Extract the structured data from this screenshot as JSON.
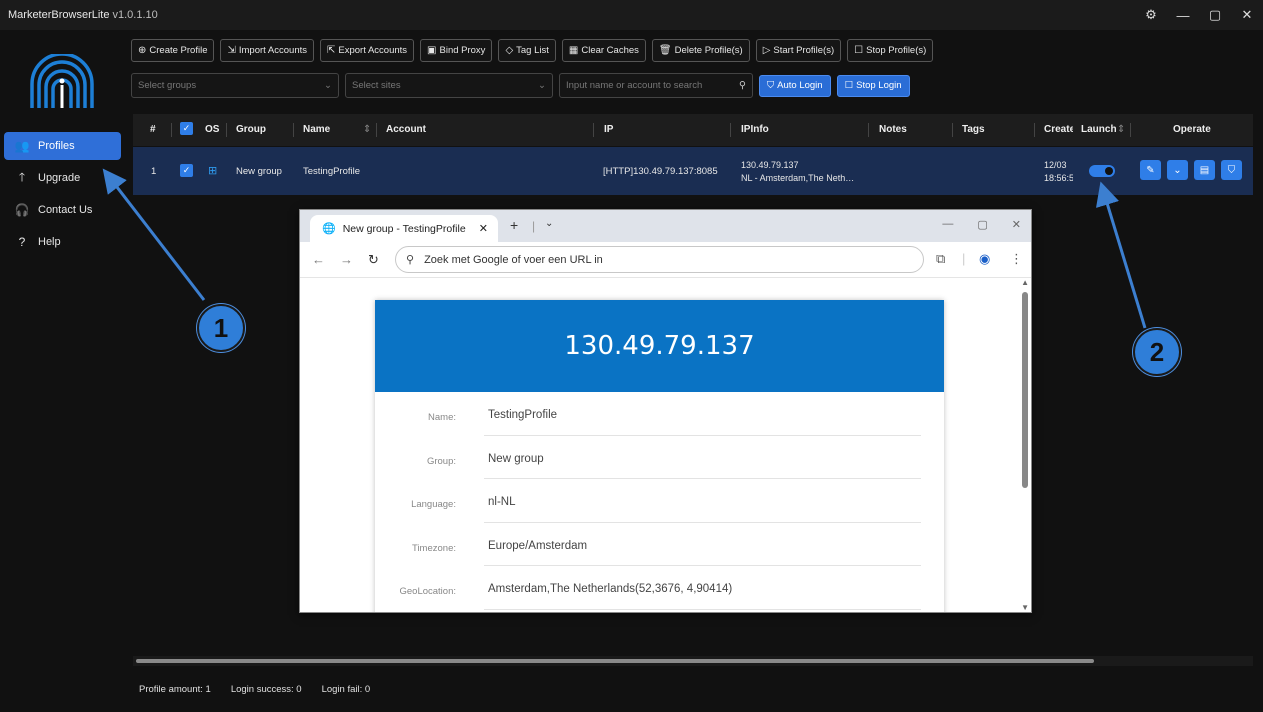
{
  "app": {
    "name": "MarketerBrowserLite",
    "version": "v1.0.1.10"
  },
  "window_controls": [
    "⚙",
    "—",
    "▢",
    "✕"
  ],
  "sidebar": {
    "items": [
      {
        "label": "Profiles",
        "icon": "users-icon",
        "active": true
      },
      {
        "label": "Upgrade",
        "icon": "arrow-up-icon",
        "active": false
      },
      {
        "label": "Contact Us",
        "icon": "headset-icon",
        "active": false
      },
      {
        "label": "Help",
        "icon": "question-icon",
        "active": false
      }
    ]
  },
  "toolbar": {
    "buttons": [
      {
        "label": "Create Profile",
        "icon": "plus-circle-icon"
      },
      {
        "label": "Import Accounts",
        "icon": "import-icon"
      },
      {
        "label": "Export Accounts",
        "icon": "export-icon"
      },
      {
        "label": "Bind Proxy",
        "icon": "proxy-icon"
      },
      {
        "label": "Tag List",
        "icon": "tag-icon"
      },
      {
        "label": "Clear Caches",
        "icon": "broom-icon"
      },
      {
        "label": "Delete Profile(s)",
        "icon": "trash-icon"
      },
      {
        "label": "Start Profile(s)",
        "icon": "play-icon"
      },
      {
        "label": "Stop Profile(s)",
        "icon": "stop-icon"
      }
    ]
  },
  "filters": {
    "groups_placeholder": "Select groups",
    "sites_placeholder": "Select sites",
    "search_placeholder": "Input name or account to search",
    "auto_login": "Auto Login",
    "stop_login": "Stop Login"
  },
  "table": {
    "headers": [
      "#",
      "OS",
      "Group",
      "Name",
      "Account",
      "IP",
      "IPInfo",
      "Notes",
      "Tags",
      "Create",
      "Launch",
      "Operate"
    ],
    "rows": [
      {
        "index": "1",
        "checked": true,
        "os": "windows-icon",
        "group": "New group",
        "name": "TestingProfile",
        "account": "",
        "ip": "[HTTP]130.49.79.137:8085",
        "ipinfo_line1": "130.49.79.137",
        "ipinfo_line2": "NL - Amsterdam,The Neth…",
        "notes": "",
        "tags": "",
        "create_line1": "12/03",
        "create_line2": "18:56:5",
        "launch_on": true
      }
    ]
  },
  "footer": {
    "profile_amount": "Profile amount: 1",
    "login_success": "Login success: 0",
    "login_fail": "Login fail: 0"
  },
  "browser": {
    "tab_title": "New group - TestingProfile",
    "omnibox_text": "Zoek met Google of voer een URL in",
    "ip_heading": "130.49.79.137",
    "fields": [
      {
        "label": "Name:",
        "value": "TestingProfile"
      },
      {
        "label": "Group:",
        "value": "New group"
      },
      {
        "label": "Language:",
        "value": "nl-NL"
      },
      {
        "label": "Timezone:",
        "value": "Europe/Amsterdam"
      },
      {
        "label": "GeoLocation:",
        "value": "Amsterdam,The Netherlands(52,3676, 4,90414)"
      }
    ]
  },
  "annotations": [
    {
      "number": "1"
    },
    {
      "number": "2"
    }
  ],
  "colors": {
    "accent": "#2f7ee8",
    "row_selected": "#1a2d52",
    "ip_banner": "#0a73c4"
  }
}
